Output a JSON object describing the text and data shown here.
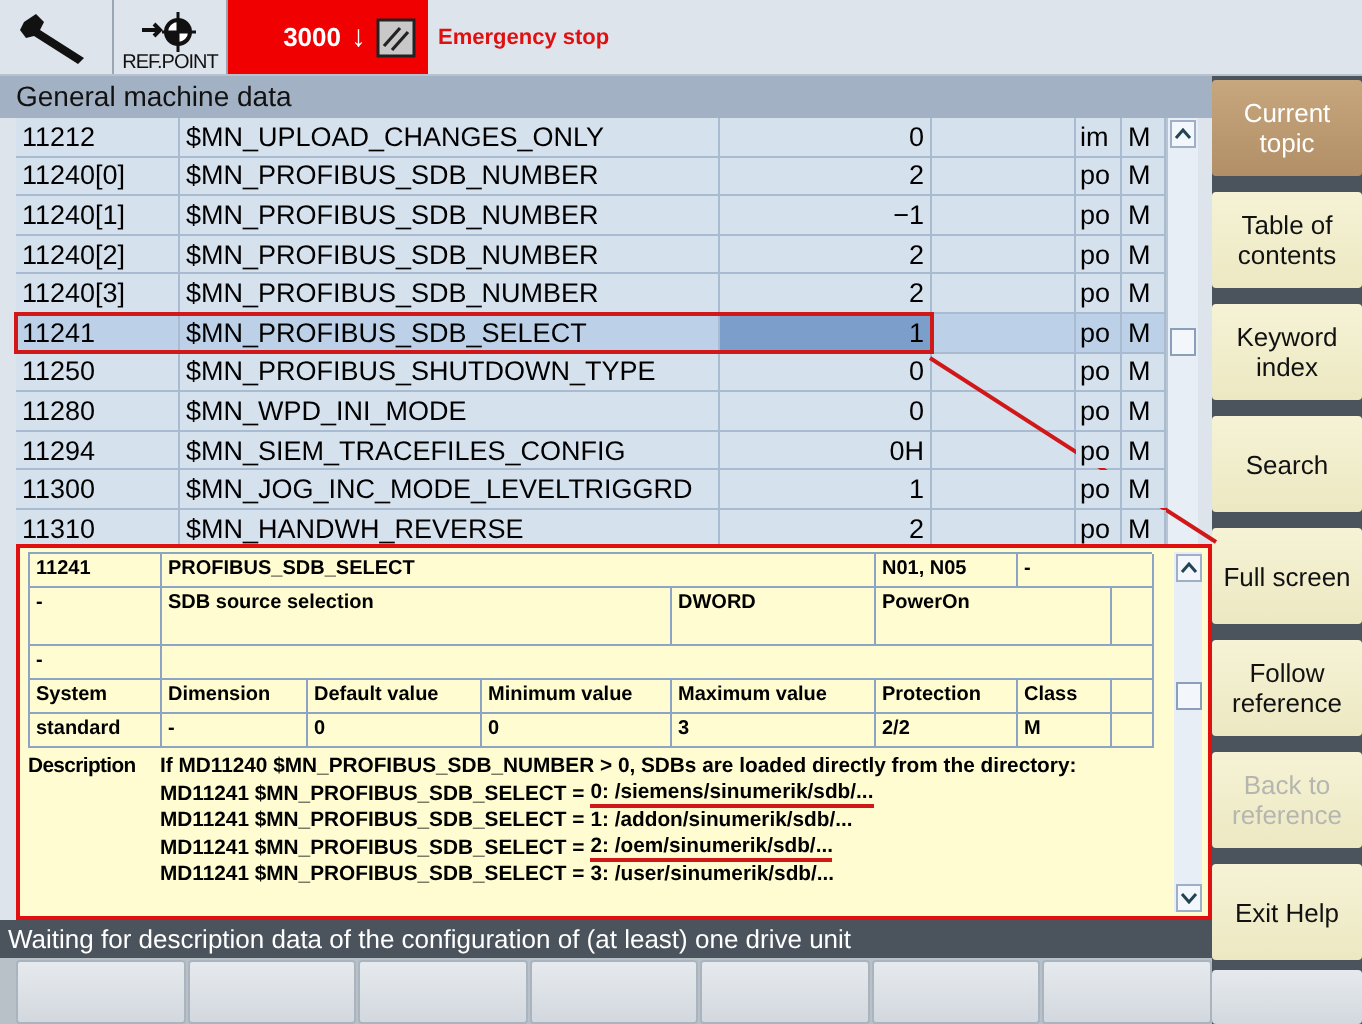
{
  "top_bar": {
    "ref_label": "REF.POINT",
    "alarm_number": "3000",
    "alarm_arrow": "↓",
    "alarm_text": "Emergency stop"
  },
  "list": {
    "title": "General machine data",
    "rows": [
      {
        "number": "11212",
        "name": "$MN_UPLOAD_CHANGES_ONLY",
        "value": "0",
        "effect": "im",
        "class": "M",
        "selected": false
      },
      {
        "number": "11240[0]",
        "name": "$MN_PROFIBUS_SDB_NUMBER",
        "value": "2",
        "effect": "po",
        "class": "M",
        "selected": false
      },
      {
        "number": "11240[1]",
        "name": "$MN_PROFIBUS_SDB_NUMBER",
        "value": "−1",
        "effect": "po",
        "class": "M",
        "selected": false
      },
      {
        "number": "11240[2]",
        "name": "$MN_PROFIBUS_SDB_NUMBER",
        "value": "2",
        "effect": "po",
        "class": "M",
        "selected": false
      },
      {
        "number": "11240[3]",
        "name": "$MN_PROFIBUS_SDB_NUMBER",
        "value": "2",
        "effect": "po",
        "class": "M",
        "selected": false
      },
      {
        "number": "11241",
        "name": "$MN_PROFIBUS_SDB_SELECT",
        "value": "1",
        "effect": "po",
        "class": "M",
        "selected": true
      },
      {
        "number": "11250",
        "name": "$MN_PROFIBUS_SHUTDOWN_TYPE",
        "value": "0",
        "effect": "po",
        "class": "M",
        "selected": false
      },
      {
        "number": "11280",
        "name": "$MN_WPD_INI_MODE",
        "value": "0",
        "effect": "po",
        "class": "M",
        "selected": false
      },
      {
        "number": "11294",
        "name": "$MN_SIEM_TRACEFILES_CONFIG",
        "value": "0H",
        "effect": "po",
        "class": "M",
        "selected": false
      },
      {
        "number": "11300",
        "name": "$MN_JOG_INC_MODE_LEVELTRIGGRD",
        "value": "1",
        "effect": "po",
        "class": "M",
        "selected": false
      },
      {
        "number": "11310",
        "name": "$MN_HANDWH_REVERSE",
        "value": "2",
        "effect": "po",
        "class": "M",
        "selected": false
      }
    ]
  },
  "help": {
    "number": "11241",
    "identifier": "PROFIBUS_SDB_SELECT",
    "channels": "N01, N05",
    "field_1": "-",
    "field_2": "-",
    "title": "SDB source selection",
    "data_type": "DWORD",
    "activation": "PowerOn",
    "field_3": "-",
    "headers": [
      "System",
      "Dimension",
      "Default value",
      "Minimum value",
      "Maximum value",
      "Protection",
      "Class"
    ],
    "values": [
      "standard",
      "-",
      "0",
      "0",
      "3",
      "2/2",
      "M"
    ],
    "description_label": "Description",
    "description": "If MD11240 $MN_PROFIBUS_SDB_NUMBER > 0, SDBs are loaded directly from the directory:",
    "options": [
      {
        "prefix": "MD11241 $MN_PROFIBUS_SDB_SELECT =",
        "path": "0: /siemens/sinumerik/sdb/...",
        "underlined": true
      },
      {
        "prefix": "MD11241 $MN_PROFIBUS_SDB_SELECT =",
        "path": "1: /addon/sinumerik/sdb/...",
        "underlined": false
      },
      {
        "prefix": "MD11241 $MN_PROFIBUS_SDB_SELECT =",
        "path": "2: /oem/sinumerik/sdb/...",
        "underlined": true
      },
      {
        "prefix": "MD11241 $MN_PROFIBUS_SDB_SELECT =",
        "path": "3: /user/sinumerik/sdb/...",
        "underlined": false
      }
    ]
  },
  "status_bar": "Waiting for description data of the configuration of (at least) one drive unit",
  "softkeys": [
    {
      "label": "Current topic",
      "selected": true,
      "disabled": false
    },
    {
      "label": "Table of contents",
      "selected": false,
      "disabled": false
    },
    {
      "label": "Keyword index",
      "selected": false,
      "disabled": false
    },
    {
      "label": "Search",
      "selected": false,
      "disabled": false
    },
    {
      "label": "Full screen",
      "selected": false,
      "disabled": false
    },
    {
      "label": "Follow reference",
      "selected": false,
      "disabled": false
    },
    {
      "label": "Back to reference",
      "selected": false,
      "disabled": true
    },
    {
      "label": "Exit Help",
      "selected": false,
      "disabled": false
    }
  ]
}
